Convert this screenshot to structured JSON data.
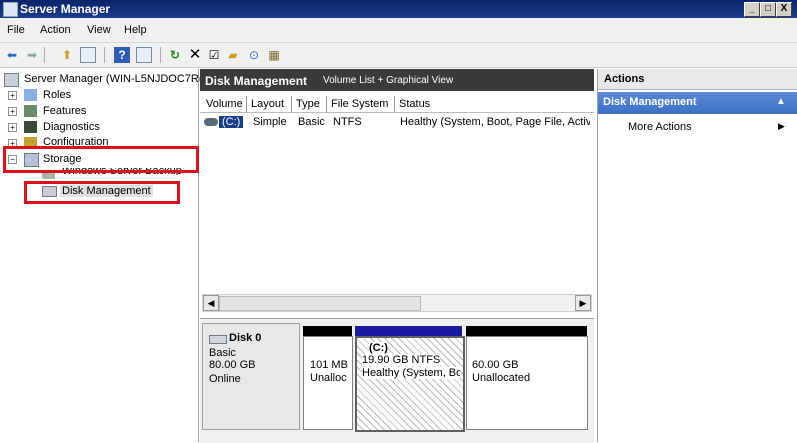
{
  "window": {
    "title": "Server Manager",
    "buttons": [
      "_",
      "□",
      "X"
    ]
  },
  "menu": [
    "File",
    "Action",
    "View",
    "Help"
  ],
  "toolbar_icons": [
    "back-icon",
    "forward-icon",
    "up-folder-icon",
    "show-hide-tree-icon",
    "help-icon",
    "show-hide-action-pane-icon",
    "refresh-icon",
    "delete-icon",
    "properties-icon",
    "open-icon",
    "search-icon",
    "rescan-icon"
  ],
  "tree": {
    "root": "Server Manager (WIN-L5NJDOC7R(",
    "items": [
      "Roles",
      "Features",
      "Diagnostics",
      "Configuration",
      "Storage"
    ],
    "storage_children": [
      "Windows Server Backup",
      "Disk Management"
    ]
  },
  "center": {
    "title": "Disk Management",
    "subtitle": "Volume List + Graphical View",
    "columns": [
      "Volume",
      "Layout",
      "Type",
      "File System",
      "Status"
    ],
    "rows": [
      {
        "volume": "(C:)",
        "layout": "Simple",
        "type": "Basic",
        "fs": "NTFS",
        "status": "Healthy (System, Boot, Page File, Activ"
      }
    ]
  },
  "disk": {
    "name": "Disk 0",
    "type": "Basic",
    "size": "80.00 GB",
    "state": "Online",
    "partitions": [
      {
        "line1": "101 MB",
        "line2": "Unalloc",
        "label": ""
      },
      {
        "label": "(C:)",
        "line1": "19.90 GB NTFS",
        "line2": "Healthy (System, Bo"
      },
      {
        "label": "",
        "line1": "60.00 GB",
        "line2": "Unallocated"
      }
    ]
  },
  "actions": {
    "title": "Actions",
    "section": "Disk Management",
    "items": [
      "More Actions"
    ]
  },
  "colors": {
    "titlebar": "#0a246a",
    "highlight_red": "#e0101a",
    "actions_section": "#3c6fc4",
    "primary_partition": "#1a1aa0"
  }
}
